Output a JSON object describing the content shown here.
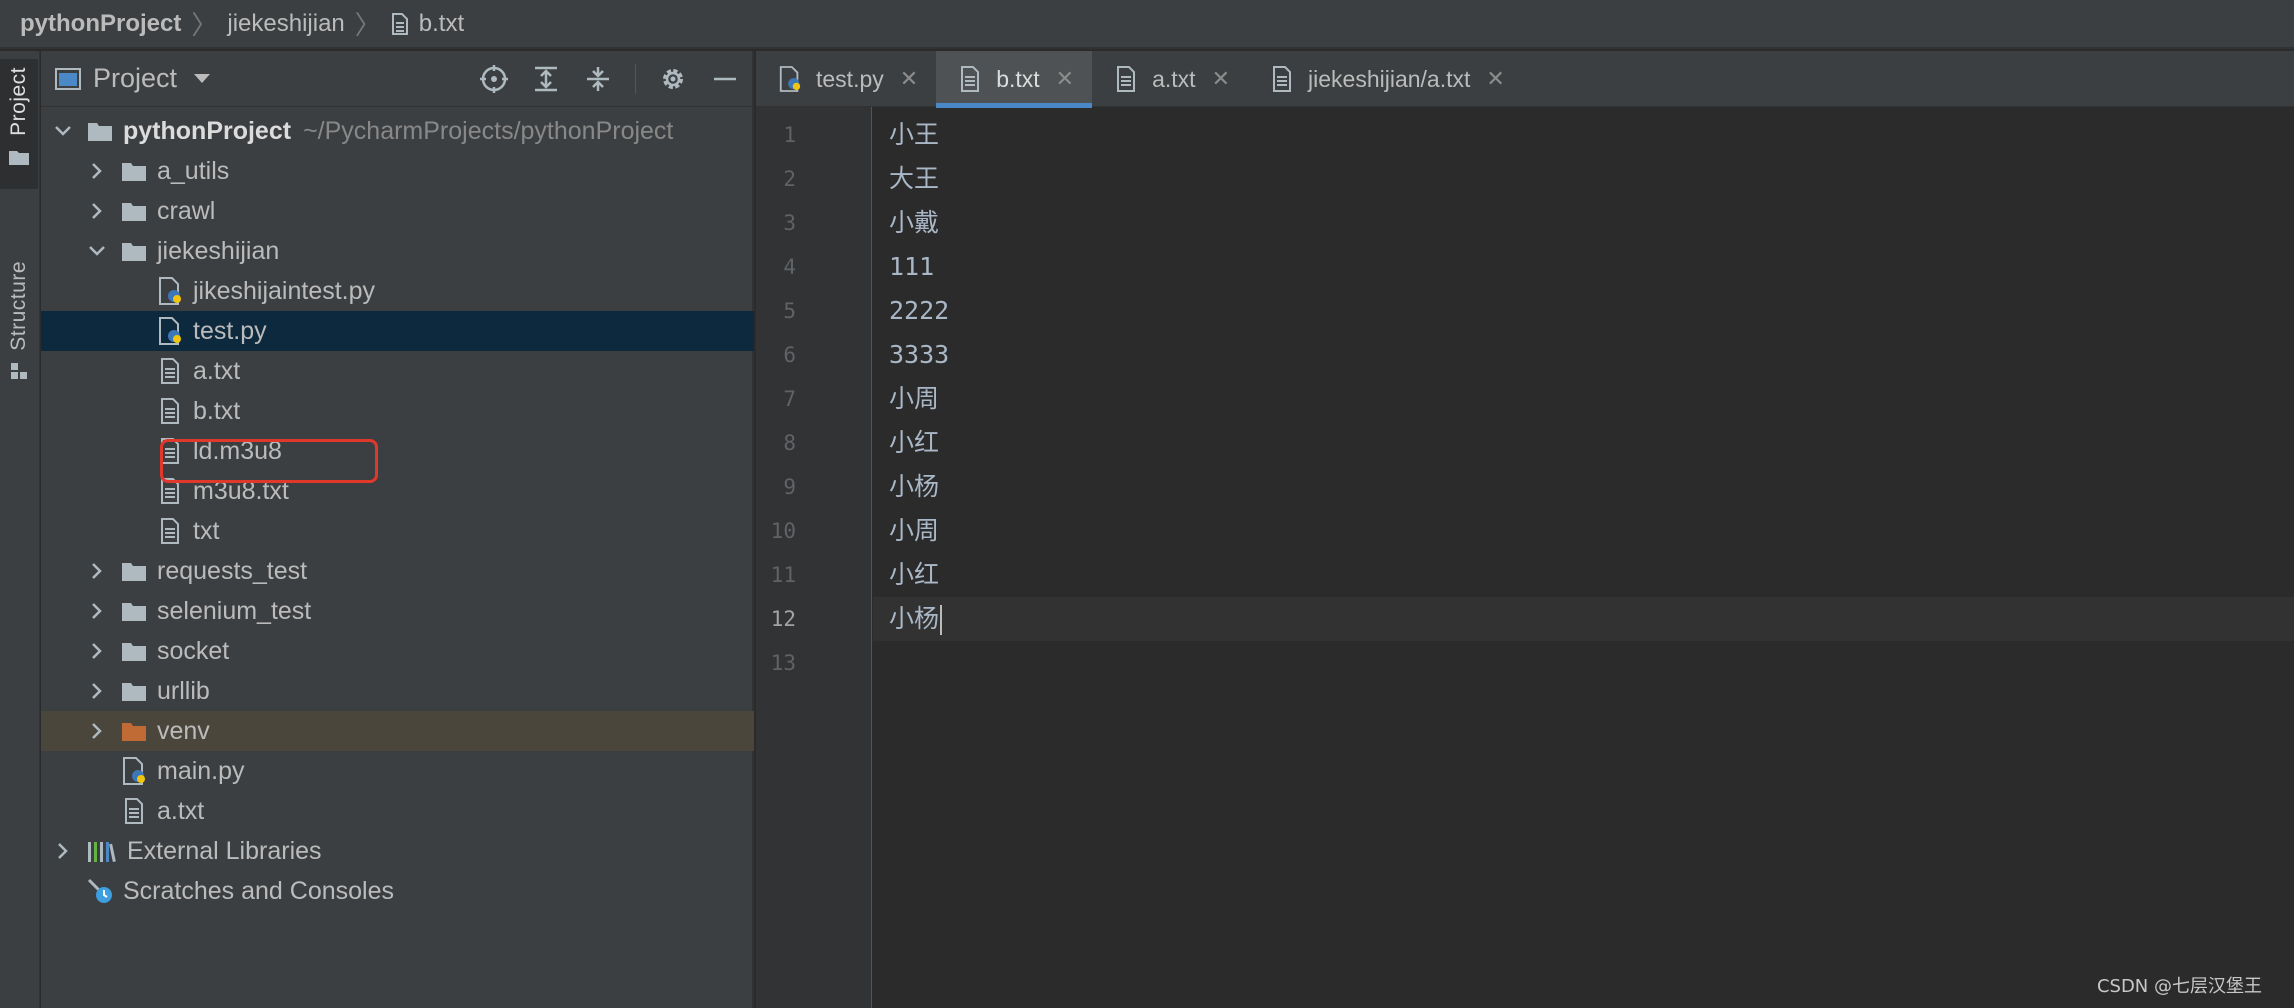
{
  "breadcrumbs": [
    "pythonProject",
    "jiekeshijian",
    "b.txt"
  ],
  "toolstrip": {
    "project_tab": "Project",
    "structure_tab": "Structure"
  },
  "project_panel": {
    "title": "Project"
  },
  "tree": {
    "root": {
      "label": "pythonProject",
      "path": "~/PycharmProjects/pythonProject"
    },
    "items": [
      {
        "label": "a_utils"
      },
      {
        "label": "crawl"
      },
      {
        "label": "jiekeshijian"
      },
      {
        "label": "jikeshijaintest.py"
      },
      {
        "label": "test.py"
      },
      {
        "label": "a.txt"
      },
      {
        "label": "b.txt"
      },
      {
        "label": "ld.m3u8"
      },
      {
        "label": "m3u8.txt"
      },
      {
        "label": "txt"
      },
      {
        "label": "requests_test"
      },
      {
        "label": "selenium_test"
      },
      {
        "label": "socket"
      },
      {
        "label": "urllib"
      },
      {
        "label": "venv"
      },
      {
        "label": "main.py"
      },
      {
        "label": "a.txt"
      },
      {
        "label": "External Libraries"
      },
      {
        "label": "Scratches and Consoles"
      }
    ]
  },
  "tabs": [
    {
      "label": "test.py"
    },
    {
      "label": "b.txt"
    },
    {
      "label": "a.txt"
    },
    {
      "label": "jiekeshijian/a.txt"
    }
  ],
  "editor": {
    "line_numbers": [
      "1",
      "2",
      "3",
      "4",
      "5",
      "6",
      "7",
      "8",
      "9",
      "10",
      "11",
      "12",
      "13"
    ],
    "lines": [
      "小王",
      "大王",
      "小戴",
      "111",
      "2222",
      "3333",
      "小周",
      "小红",
      "小杨",
      "小周",
      "小红",
      "小杨",
      ""
    ]
  },
  "watermark": "CSDN @七层汉堡王",
  "colors": {
    "selection": "#0d293e",
    "tab_underline": "#4a88c7",
    "highlight_box": "#e0382b",
    "venv_folder": "#c06a35"
  }
}
